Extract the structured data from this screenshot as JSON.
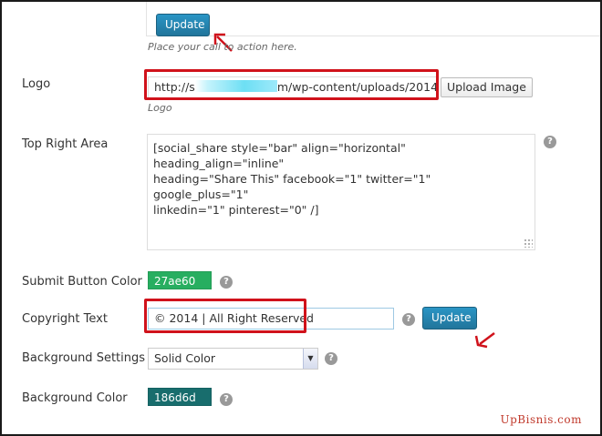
{
  "top": {
    "update_label": "Update",
    "hint": "Place your call to action here."
  },
  "logo": {
    "label": "Logo",
    "value_start": "http://s",
    "value_end": "m/wp-content/uploads/2014",
    "upload_label": "Upload Image",
    "hint": "Logo"
  },
  "top_right_area": {
    "label": "Top Right Area",
    "lines": [
      "[social_share style=\"bar\" align=\"horizontal\" heading_align=\"inline\"",
      "heading=\"Share This\" facebook=\"1\" twitter=\"1\" google_plus=\"1\"",
      "linkedin=\"1\" pinterest=\"0\" /]"
    ],
    "help": "?"
  },
  "submit_button_color": {
    "label": "Submit Button Color",
    "value": "27ae60",
    "color": "#27ae60",
    "help": "?"
  },
  "copyright": {
    "label": "Copyright Text",
    "value": "© 2014 | All Right Reserved",
    "help": "?",
    "update_label": "Update"
  },
  "background_settings": {
    "label": "Background Settings",
    "selected": "Solid Color",
    "help": "?"
  },
  "background_color": {
    "label": "Background Color",
    "value": "186d6d",
    "color": "#186d6d",
    "help": "?"
  },
  "watermark": "UpBisnis.com",
  "colors": {
    "accent": "#21759b",
    "highlight": "#d0121b"
  }
}
